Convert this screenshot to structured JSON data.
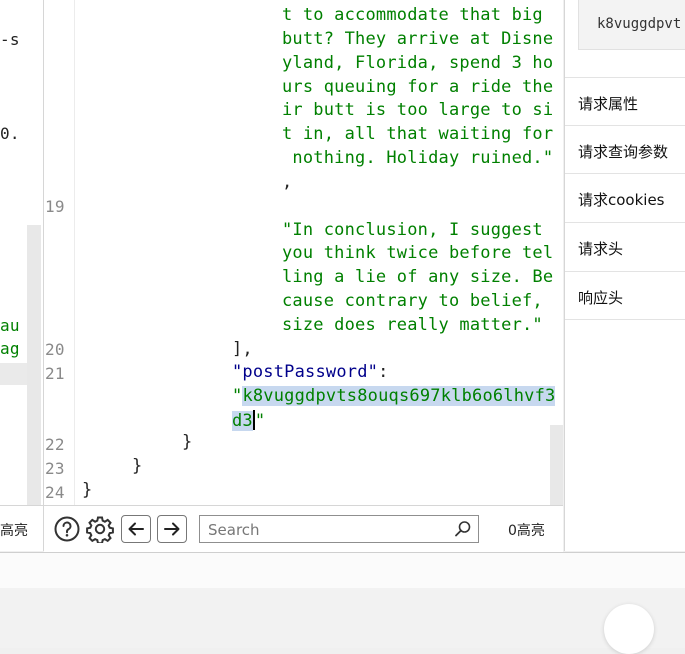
{
  "left_pane": {
    "fragments": [
      "-s",
      "0.",
      "au",
      "ag"
    ],
    "toolbar_label": "高亮"
  },
  "editor": {
    "line_numbers": [
      "19",
      "20",
      "21",
      "22",
      "23",
      "24"
    ],
    "string_lines_a": [
      "t to accommodate that big",
      "butt? They arrive at Disne",
      "yland, Florida, spend 3 ho",
      "urs queuing for a ride the",
      "ir butt is too large to si",
      "t in, all that waiting for",
      " nothing. Holiday ruined.\""
    ],
    "comma": ",",
    "string_lines_b": [
      "\"In conclusion, I suggest",
      "you think twice before tel",
      "ling a lie of any size. Be",
      "cause contrary to belief,",
      "size does really matter.\""
    ],
    "close_array": "],",
    "key_post_password": "\"postPassword\"",
    "colon": ":",
    "value_open_quote": "\"",
    "value_part1": "k8vuggdpvts8ouqs697klb6o6lhvf3",
    "value_part2": "d3",
    "value_close_quote": "\"",
    "close_brace_1": "}",
    "close_brace_2": "}",
    "close_brace_3": "}"
  },
  "toolbar": {
    "help_icon": "question-circle-icon",
    "settings_icon": "gear-icon",
    "prev_icon": "arrow-left-icon",
    "next_icon": "arrow-right-icon",
    "search_placeholder": "Search",
    "search_icon": "magnifier-icon",
    "highlight_count": "0高亮"
  },
  "right_panel": {
    "password_value": "k8vuggdpvt",
    "menu": [
      "请求属性",
      "请求查询参数",
      "请求cookies",
      "请求头",
      "响应头"
    ]
  }
}
